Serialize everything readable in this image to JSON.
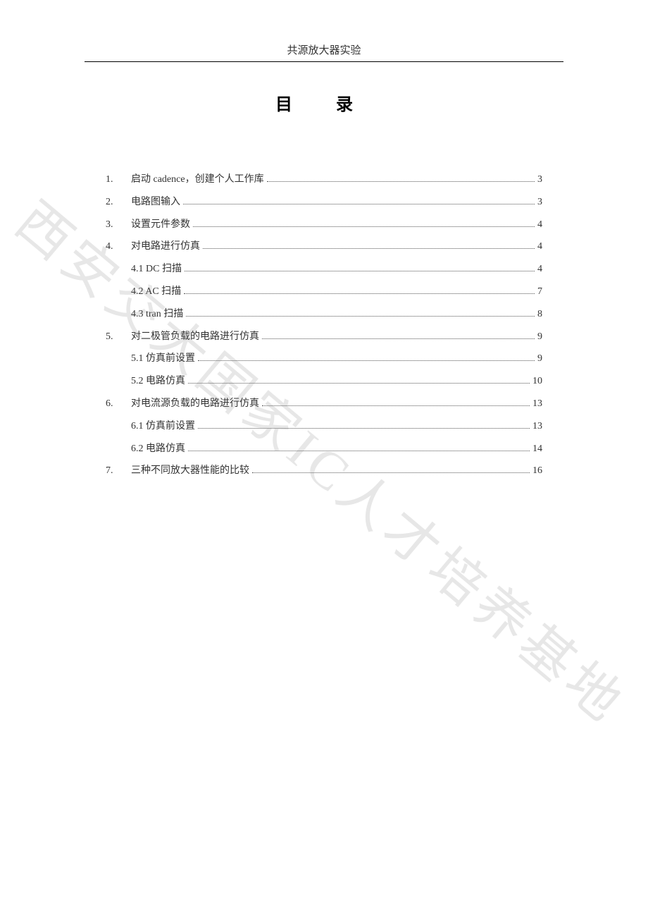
{
  "header": "共源放大器实验",
  "title": "目 录",
  "watermark": "西安交大国家IC人才培养基地",
  "toc": [
    {
      "num": "1.",
      "label": "启动 cadence，创建个人工作库",
      "page": "3",
      "indent": 0
    },
    {
      "num": "2.",
      "label": "电路图输入",
      "page": "3",
      "indent": 0
    },
    {
      "num": "3.",
      "label": "设置元件参数",
      "page": "4",
      "indent": 0
    },
    {
      "num": "4.",
      "label": "对电路进行仿真",
      "page": "4",
      "indent": 0
    },
    {
      "num": "",
      "label": "4.1 DC 扫描",
      "page": "4",
      "indent": 1
    },
    {
      "num": "",
      "label": "4.2 AC 扫描",
      "page": "7",
      "indent": 1
    },
    {
      "num": "",
      "label": "4.3 tran 扫描",
      "page": "8",
      "indent": 1
    },
    {
      "num": "5.",
      "label": "对二极管负载的电路进行仿真",
      "page": "9",
      "indent": 0
    },
    {
      "num": "",
      "label": "5.1  仿真前设置",
      "page": "9",
      "indent": 1
    },
    {
      "num": "",
      "label": "5.2  电路仿真",
      "page": "10",
      "indent": 1
    },
    {
      "num": "6.",
      "label": "对电流源负载的电路进行仿真",
      "page": "13",
      "indent": 0
    },
    {
      "num": "",
      "label": "6.1 仿真前设置",
      "page": "13",
      "indent": 1
    },
    {
      "num": "",
      "label": "6.2 电路仿真",
      "page": "14",
      "indent": 1
    },
    {
      "num": "7.",
      "label": "三种不同放大器性能的比较",
      "page": "16",
      "indent": 0
    }
  ]
}
